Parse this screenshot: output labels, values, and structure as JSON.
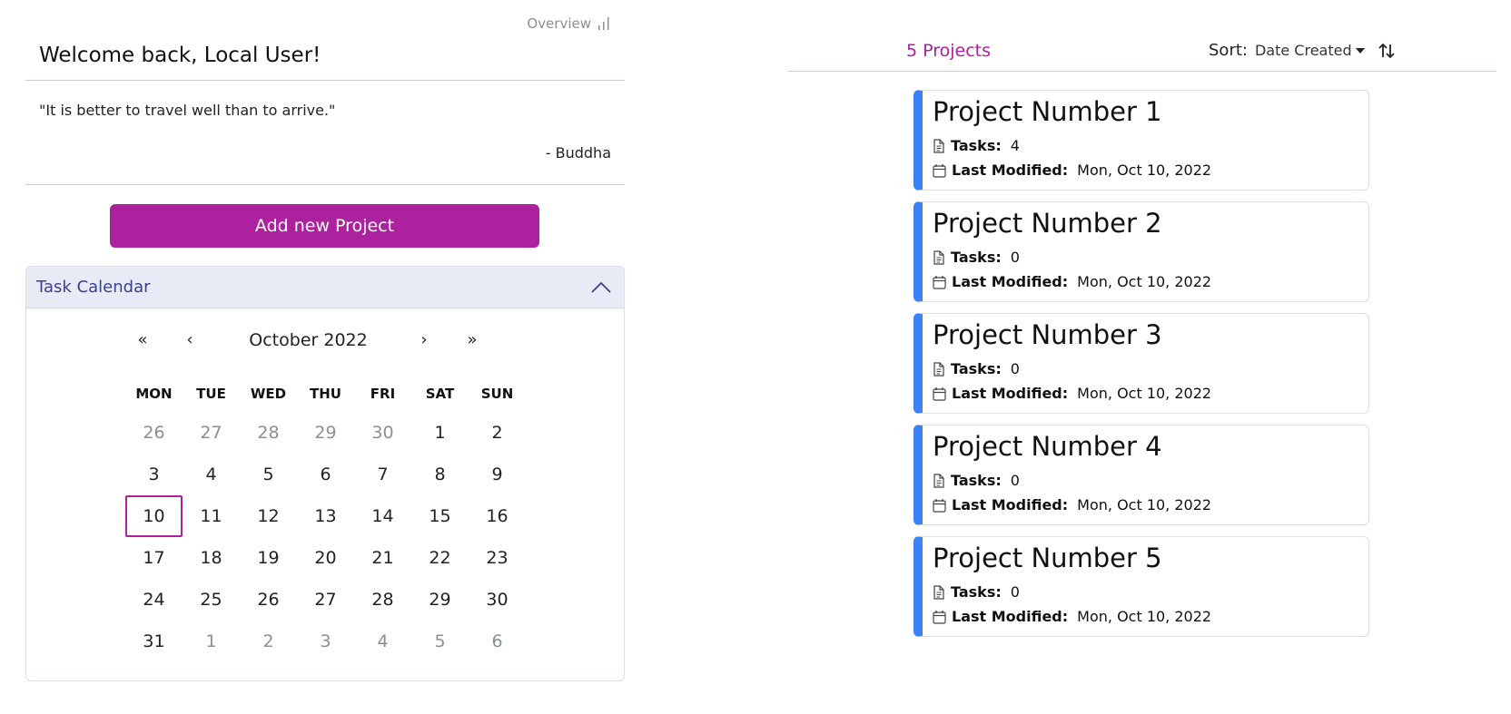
{
  "header": {
    "overview_label": "Overview",
    "welcome": "Welcome back, Local User!"
  },
  "quote": {
    "text": "\"It is better to travel well than to arrive.\"",
    "author": "- Buddha"
  },
  "add_button_label": "Add new Project",
  "calendar": {
    "title": "Task Calendar",
    "month_label": "October 2022",
    "nav": {
      "prev_year": "«",
      "prev_month": "‹",
      "next_month": "›",
      "next_year": "»"
    },
    "weekdays": [
      "MON",
      "TUE",
      "WED",
      "THU",
      "FRI",
      "SAT",
      "SUN"
    ],
    "weeks": [
      [
        {
          "d": "26",
          "m": true
        },
        {
          "d": "27",
          "m": true
        },
        {
          "d": "28",
          "m": true
        },
        {
          "d": "29",
          "m": true
        },
        {
          "d": "30",
          "m": true
        },
        {
          "d": "1"
        },
        {
          "d": "2"
        }
      ],
      [
        {
          "d": "3"
        },
        {
          "d": "4"
        },
        {
          "d": "5"
        },
        {
          "d": "6"
        },
        {
          "d": "7"
        },
        {
          "d": "8"
        },
        {
          "d": "9"
        }
      ],
      [
        {
          "d": "10",
          "t": true
        },
        {
          "d": "11"
        },
        {
          "d": "12"
        },
        {
          "d": "13"
        },
        {
          "d": "14"
        },
        {
          "d": "15"
        },
        {
          "d": "16"
        }
      ],
      [
        {
          "d": "17"
        },
        {
          "d": "18"
        },
        {
          "d": "19"
        },
        {
          "d": "20"
        },
        {
          "d": "21"
        },
        {
          "d": "22"
        },
        {
          "d": "23"
        }
      ],
      [
        {
          "d": "24"
        },
        {
          "d": "25"
        },
        {
          "d": "26"
        },
        {
          "d": "27"
        },
        {
          "d": "28"
        },
        {
          "d": "29"
        },
        {
          "d": "30"
        }
      ],
      [
        {
          "d": "31"
        },
        {
          "d": "1",
          "m": true
        },
        {
          "d": "2",
          "m": true
        },
        {
          "d": "3",
          "m": true
        },
        {
          "d": "4",
          "m": true
        },
        {
          "d": "5",
          "m": true
        },
        {
          "d": "6",
          "m": true
        }
      ]
    ],
    "today_color": "#ab219e"
  },
  "projects_header": {
    "count_label": "5 Projects",
    "sort_label": "Sort:",
    "sort_value": "Date Created"
  },
  "project_labels": {
    "tasks": "Tasks:",
    "last_modified": "Last Modified:"
  },
  "projects": [
    {
      "name": "Project Number 1",
      "tasks": "4",
      "last_modified": "Mon, Oct 10, 2022"
    },
    {
      "name": "Project Number 2",
      "tasks": "0",
      "last_modified": "Mon, Oct 10, 2022"
    },
    {
      "name": "Project Number 3",
      "tasks": "0",
      "last_modified": "Mon, Oct 10, 2022"
    },
    {
      "name": "Project Number 4",
      "tasks": "0",
      "last_modified": "Mon, Oct 10, 2022"
    },
    {
      "name": "Project Number 5",
      "tasks": "0",
      "last_modified": "Mon, Oct 10, 2022"
    }
  ],
  "colors": {
    "accent": "#ab219e",
    "card_border": "#3b82f6",
    "calendar_header_bg": "#e8eaf6"
  },
  "icons": {
    "overview": "bar-chart-icon",
    "collapse": "chevron-up-icon",
    "sort_toggle": "sort-arrows-icon",
    "tasks": "file-text-icon",
    "date": "calendar-icon"
  }
}
